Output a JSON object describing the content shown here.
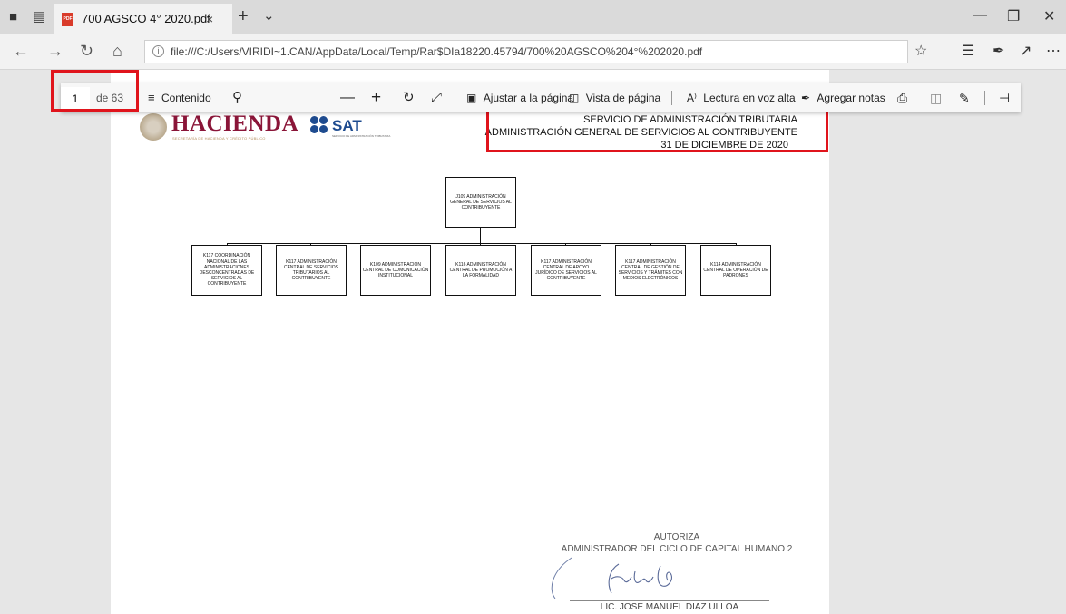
{
  "browser": {
    "tab_title": "700 AGSCO 4° 2020.pdf",
    "tab_close": "×",
    "new_tab": "+",
    "address_url": "file:///C:/Users/VIRIDI~1.CAN/AppData/Local/Temp/Rar$DIa18220.45794/700%20AGSCO%204°%202020.pdf"
  },
  "pdf_toolbar": {
    "page_current": "1",
    "page_total": "de 63",
    "contents_label": "Contenido",
    "fit_page_label": "Ajustar a la página",
    "page_view_label": "Vista de página",
    "read_aloud_label": "Lectura en voz alta",
    "add_notes_label": "Agregar notas"
  },
  "document": {
    "logo_hacienda": "HACIENDA",
    "logo_hacienda_sub": "SECRETARÍA DE HACIENDA Y CRÉDITO PÚBLICO",
    "logo_sat": "SAT",
    "logo_sat_sub": "SERVICIO DE ADMINISTRACIÓN TRIBUTARIA",
    "header_lines": [
      "SERVICIO DE ADMINISTRACIÓN TRIBUTARIA",
      "ADMINISTRACIÓN GENERAL DE SERVICIOS AL CONTRIBUYENTE",
      "31 DE DICIEMBRE DE 2020"
    ],
    "org_root": "J109 ADMINISTRACIÓN GENERAL DE SERVICIOS AL CONTRIBUYENTE",
    "org_children": [
      "K117 COORDINACIÓN NACIONAL DE LAS ADMINISTRACIONES DESCONCENTRADAS DE SERVICIOS AL CONTRIBUYENTE",
      "K117 ADMINISTRACIÓN CENTRAL DE SERVICIOS TRIBUTARIOS AL CONTRIBUYENTE",
      "K109 ADMINISTRACIÓN CENTRAL DE COMUNICACIÓN INSTITUCIONAL",
      "K116 ADMINISTRACIÓN CENTRAL DE PROMOCIÓN A LA FORMALIDAD",
      "K117 ADMINISTRACIÓN CENTRAL DE APOYO JURÍDICO DE SERVICIOS AL CONTRIBUYENTE",
      "K117 ADMINISTRACIÓN CENTRAL DE GESTIÓN DE SERVICIOS Y TRÁMITES CON MEDIOS ELECTRÓNICOS",
      "K114 ADMINISTRACIÓN CENTRAL DE OPERACIÓN DE PADRONES"
    ],
    "authorize_label": "AUTORIZA",
    "authorize_role": "ADMINISTRADOR DEL CICLO DE CAPITAL HUMANO 2",
    "signatory": "LIC. JOSE MANUEL DIAZ ULLOA"
  },
  "colors": {
    "highlight": "#e0141c",
    "hacienda": "#8a1538",
    "sat": "#1e4b8f"
  }
}
